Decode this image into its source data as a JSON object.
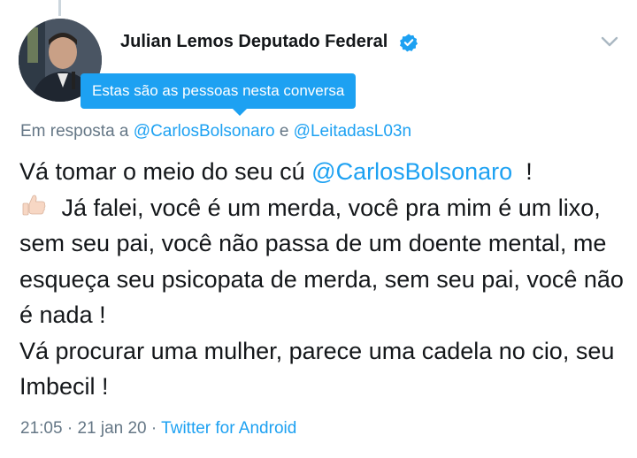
{
  "tweet": {
    "author_name": "Julian Lemos Deputado Federal",
    "tooltip": "Estas são as pessoas nesta conversa",
    "reply": {
      "prefix": "Em resposta a",
      "mention1": "@CarlosBolsonaro",
      "connector": "e",
      "mention2": "@LeitadasL03n"
    },
    "body": {
      "seg1": "Vá tomar o meio do seu cú ",
      "mention": "@CarlosBolsonaro",
      "seg2": "  !",
      "emoji": "thumbs-up",
      "seg3": " Já falei, você é um merda, você pra mim é um lixo, sem seu pai, você não passa de um doente mental, me esqueça seu psicopata de merda, sem seu pai, você não é nada !\nVá procurar uma mulher, parece uma cadela no cio, seu Imbecil !"
    },
    "meta": {
      "time": "21:05",
      "sep1": "·",
      "date": "21 jan 20",
      "sep2": "·",
      "source": "Twitter for Android"
    }
  },
  "icons": {
    "verified": "verified-badge-icon",
    "menu": "chevron-down-icon"
  },
  "colors": {
    "accent": "#1da1f2",
    "text": "#14171a",
    "secondary": "#657786"
  }
}
